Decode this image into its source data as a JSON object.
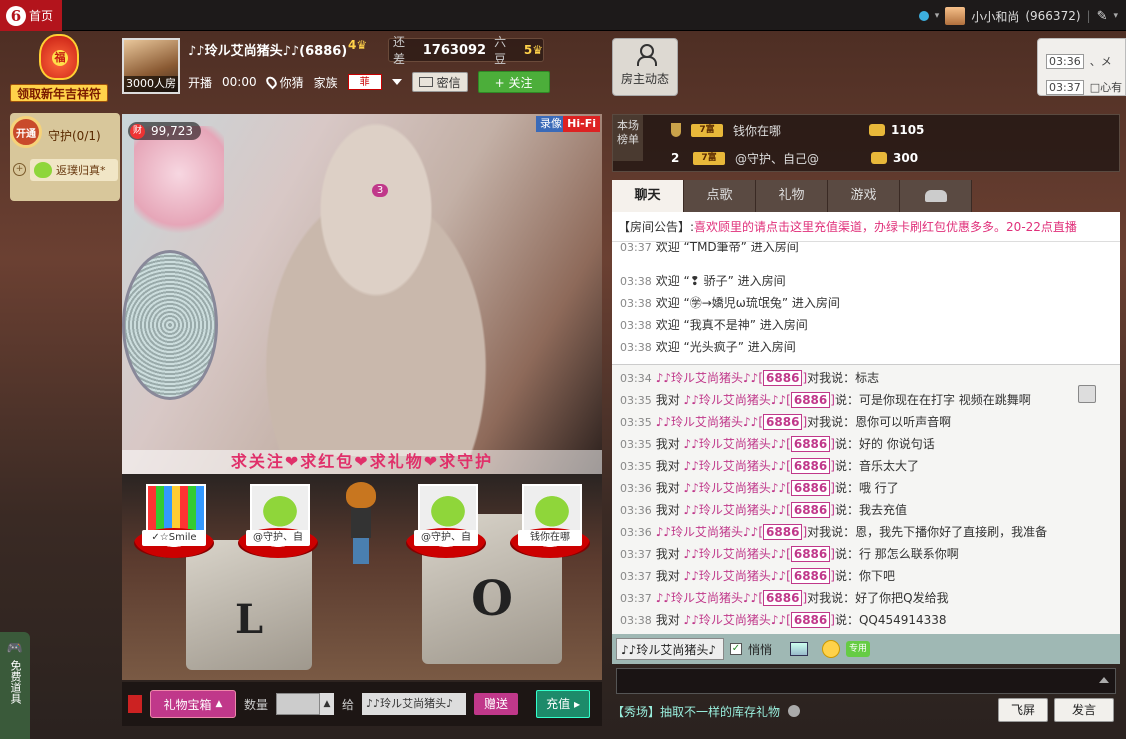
{
  "topbar": {
    "logo": "6",
    "home_label": "首页",
    "user_name": "小小和尚",
    "user_id": "(966372)"
  },
  "promo": {
    "bag_char": "福",
    "label": "领取新年吉祥符"
  },
  "guard": {
    "open_label": "开通",
    "label": "守护(0/1)",
    "return_label": "返璞归真*"
  },
  "free_tools": "免费道具",
  "host": {
    "fans_label": "3000人房",
    "name": "♪♪玲ル艾尚猪头♪♪(6886)",
    "level": "4",
    "gap_label": "还差",
    "gap_value": "1763092",
    "gap_unit": "六豆",
    "next_level": "5",
    "broadcast_label": "开播",
    "broadcast_time": "00:00",
    "location": "你猜",
    "family_label": "家族",
    "family_tag": "菲",
    "message_button": "密信",
    "follow_button": "+ 关注"
  },
  "owner_button": "房主动态",
  "time_pop": {
    "rows": [
      {
        "time": "03:36",
        "text": "、メ"
      },
      {
        "time": "03:37",
        "text": "□心有"
      }
    ]
  },
  "video": {
    "counter": "99,723",
    "fortune_char": "财",
    "rec_label": "录像",
    "hifi_label": "Hi-Fi",
    "banner": "求关注❤求红包❤求礼物❤求守护"
  },
  "stage": {
    "seats": [
      {
        "label": "✓☆Smile",
        "kind": "jelly"
      },
      {
        "label": "@守护、自",
        "kind": "alien"
      },
      {
        "label": "@守护、自",
        "kind": "alien"
      },
      {
        "label": "钱你在哪",
        "kind": "alien"
      }
    ],
    "cube_letters": [
      "L",
      "O"
    ]
  },
  "giftbar": {
    "treasure_button": "礼物宝箱",
    "qty_label": "数量",
    "to_label": "给",
    "to_value": "♪♪玲ル艾尚猪头♪",
    "give_button": "赠送",
    "recharge_button": "充值"
  },
  "ranking": {
    "tag": "本场榜单",
    "rows": [
      {
        "rank": "",
        "vip": "7富",
        "user": "钱你在哪",
        "coins": "1105"
      },
      {
        "rank": "2",
        "vip": "7富",
        "user": "@守护、自己@",
        "coins": "300"
      }
    ]
  },
  "tabs": [
    "聊天",
    "点歌",
    "礼物",
    "游戏"
  ],
  "car_badge": "3",
  "notice": {
    "label": "【房间公告】:",
    "text": "喜欢顾里的请点击这里充值渠道，办绿卡刷红包优惠多多。20-22点直播"
  },
  "welcome": [
    {
      "time": "03:37",
      "text": "欢迎 “TMD筆帝” 进入房间"
    },
    {
      "time": "03:38",
      "text": "欢迎 “❢ 骄子” 进入房间"
    },
    {
      "time": "03:38",
      "text": "欢迎 “㊫→嬌児ω琉氓兔” 进入房间"
    },
    {
      "time": "03:38",
      "text": "欢迎 “我真不是神” 进入房间"
    },
    {
      "time": "03:38",
      "text": "欢迎 “光头疯子” 进入房间"
    }
  ],
  "chat": [
    {
      "time": "03:34",
      "pre": "",
      "nick": "♪♪玲ル艾尚猪头♪♪",
      "id": "6886",
      "post": "对我说：标志"
    },
    {
      "time": "03:35",
      "pre": "我对 ",
      "nick": "♪♪玲ル艾尚猪头♪♪",
      "id": "6886",
      "post": "说：可是你现在在打字 视频在跳舞啊"
    },
    {
      "time": "03:35",
      "pre": "",
      "nick": "♪♪玲ル艾尚猪头♪♪",
      "id": "6886",
      "post": "对我说：恩你可以听声音啊"
    },
    {
      "time": "03:35",
      "pre": "我对 ",
      "nick": "♪♪玲ル艾尚猪头♪♪",
      "id": "6886",
      "post": "说：好的 你说句话"
    },
    {
      "time": "03:35",
      "pre": "我对 ",
      "nick": "♪♪玲ル艾尚猪头♪♪",
      "id": "6886",
      "post": "说：音乐太大了"
    },
    {
      "time": "03:36",
      "pre": "我对 ",
      "nick": "♪♪玲ル艾尚猪头♪♪",
      "id": "6886",
      "post": "说：哦 行了"
    },
    {
      "time": "03:36",
      "pre": "我对 ",
      "nick": "♪♪玲ル艾尚猪头♪♪",
      "id": "6886",
      "post": "说：我去充值"
    },
    {
      "time": "03:36",
      "pre": "",
      "nick": "♪♪玲ル艾尚猪头♪♪",
      "id": "6886",
      "post": "对我说：恩，我先下播你好了直接刷，我准备"
    },
    {
      "time": "03:37",
      "pre": "我对 ",
      "nick": "♪♪玲ル艾尚猪头♪♪",
      "id": "6886",
      "post": "说：行 那怎么联系你啊"
    },
    {
      "time": "03:37",
      "pre": "我对 ",
      "nick": "♪♪玲ル艾尚猪头♪♪",
      "id": "6886",
      "post": "说：你下吧"
    },
    {
      "time": "03:37",
      "pre": "",
      "nick": "♪♪玲ル艾尚猪头♪♪",
      "id": "6886",
      "post": "对我说：好了你把Q发给我"
    },
    {
      "time": "03:38",
      "pre": "我对 ",
      "nick": "♪♪玲ル艾尚猪头♪♪",
      "id": "6886",
      "post": "说：QQ454914338"
    }
  ],
  "chatbar": {
    "target": "♪♪玲ル艾尚猪头♪",
    "whisper_label": "悄悄",
    "special_label": "专用"
  },
  "bottom": {
    "show_link": "【秀场】抽取不一样的库存礼物",
    "fly_button": "飞屏",
    "send_button": "发言"
  },
  "colors": {
    "accent": "#c0388a",
    "home_red": "#b3141c",
    "follow_green": "#4cae3a"
  }
}
